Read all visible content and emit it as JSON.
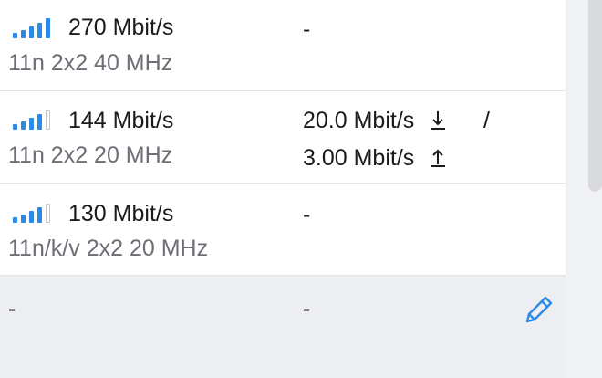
{
  "rows": [
    {
      "signal_level": 5,
      "rate": "270 Mbit/s",
      "mode": "11n 2x2 40 MHz",
      "throughput": "-"
    },
    {
      "signal_level": 4,
      "rate": "144 Mbit/s",
      "mode": "11n 2x2 20 MHz",
      "throughput_down": "20.0 Mbit/s",
      "separator": "/",
      "throughput_up": "3.00 Mbit/s"
    },
    {
      "signal_level": 4,
      "rate": "130 Mbit/s",
      "mode": "11n/k/v 2x2 20 MHz",
      "throughput": "-"
    },
    {
      "col1": "-",
      "col2": "-"
    }
  ],
  "colors": {
    "signal_active": "#2b8ae6",
    "signal_inactive": "#c5c7cb",
    "edit_icon": "#2b8ae6",
    "highlight_row": "#eceef1"
  },
  "icons": {
    "edit": "pencil-icon",
    "download": "arrow-down-icon",
    "upload": "arrow-up-icon",
    "signal": "signal-bars-icon"
  }
}
